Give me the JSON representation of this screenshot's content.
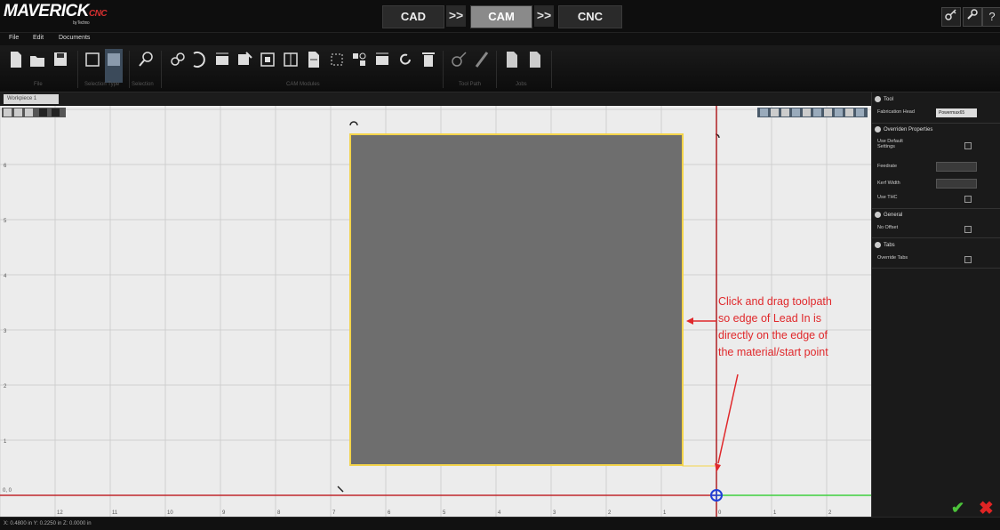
{
  "app": {
    "logo_main": "MAVERICK",
    "logo_suffix": "CNC",
    "logo_sub": "by Techno"
  },
  "workflow": {
    "steps": [
      "CAD",
      "CAM",
      "CNC"
    ],
    "active": "CAM",
    "arrow": ">>"
  },
  "top_right_icons": [
    "key-icon",
    "wrench-icon",
    "help-icon"
  ],
  "help_glyph": "?",
  "menu": [
    "File",
    "Edit",
    "Documents"
  ],
  "ribbon": {
    "groups": [
      "File",
      "Selection Type",
      "Selection",
      "CAM Modules",
      "Tool Path",
      "Jobs"
    ],
    "tools": [
      "new-file",
      "open-folder",
      "save",
      "select-rect",
      "select-fill",
      "pan-zoom",
      "tool-link",
      "tool-lead",
      "tool-3",
      "tool-4",
      "tool-5",
      "tool-6",
      "tool-7",
      "tool-8",
      "tool-9",
      "tool-10",
      "tool-11",
      "refresh",
      "trash",
      "toolpath-edit",
      "pencil",
      "job-1",
      "job-2"
    ]
  },
  "document_tab": "Workpiece 1",
  "canvas": {
    "x_ticks": [
      "12",
      "11",
      "10",
      "9",
      "8",
      "7",
      "6",
      "5",
      "4",
      "3",
      "2",
      "1",
      "0",
      "1",
      "2"
    ],
    "y_ticks": [
      "6",
      "5",
      "4",
      "3",
      "2",
      "1"
    ],
    "origin_label": "0, 0"
  },
  "annotation": {
    "lines": [
      "Click and drag toolpath",
      "so edge of Lead In is",
      "directly on the edge of",
      "the material/start point"
    ],
    "color": "#e0282b"
  },
  "panel": {
    "tool": {
      "title": "Tool",
      "label": "Fabrication Head",
      "value": "Powermax65"
    },
    "override": {
      "title": "Overriden Properties",
      "use_default": "Use Default Settings",
      "feedrate": "Feedrate",
      "kerf": "Kerf Width",
      "thc": "Use THC"
    },
    "general": {
      "title": "General",
      "no_offset": "No Offset"
    },
    "tabs": {
      "title": "Tabs",
      "override": "Override Tabs"
    }
  },
  "status": "X: 0.4800 in    Y: 0.2250 in    Z: 0.0000 in",
  "colors": {
    "accent_red": "#d32f2f",
    "material_fill": "#6e6e6e",
    "material_outline": "#f3d34a",
    "axis_y": "#b01e23",
    "axis_x": "#c0262c",
    "axis_x_pos": "#3fcf3f",
    "origin": "#1f3fd8"
  }
}
